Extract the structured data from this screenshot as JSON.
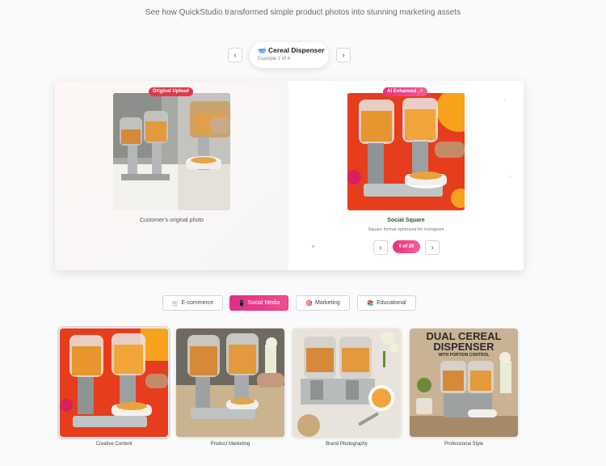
{
  "header": {
    "subtitle": "See how QuickStudio transformed simple product photos into stunning marketing assets"
  },
  "example_nav": {
    "prev_icon": "‹",
    "next_icon": "›",
    "title_icon": "🥣",
    "title": "Cereal Dispenser",
    "subtitle": "Example 1 of 4"
  },
  "comparison": {
    "original": {
      "badge": "Original Upload",
      "caption": "Customer's original photo"
    },
    "enhanced": {
      "badge": "AI Enhanced ✨",
      "caption": "Social Square",
      "description": "Square format optimized for Instagram",
      "counter": "8 of 20",
      "prev_icon": "‹",
      "next_icon": "›"
    }
  },
  "tabs": [
    {
      "icon": "🛒",
      "label": "E-commerce"
    },
    {
      "icon": "📱",
      "label": "Social Media"
    },
    {
      "icon": "🎯",
      "label": "Marketing"
    },
    {
      "icon": "📚",
      "label": "Educational"
    }
  ],
  "active_tab": "Social Media",
  "thumbnails": [
    {
      "label": "Creative Content"
    },
    {
      "label": "Product Marketing"
    },
    {
      "label": "Brand Photography"
    },
    {
      "label": "Professional Style",
      "overlay_title": "DUAL CEREAL DISPENSER",
      "overlay_sub": "WITH PORTION CONTROL"
    }
  ],
  "colors": {
    "accent": "#e8317c",
    "original_badge": "#e0394d",
    "social_bg": "#e8411f",
    "social_accent": "#f7a21b"
  }
}
